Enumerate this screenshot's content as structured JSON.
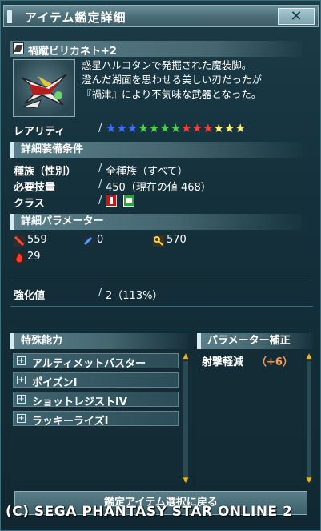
{
  "window": {
    "title": "アイテム鑑定詳細",
    "close_label": "✕"
  },
  "item": {
    "name": "禍蹴ビリカネト+2",
    "type_icon": "weapon-type-icon",
    "description": [
      "惑星ハルコタンで発掘された魔装脚。",
      "澄んだ湖面を思わせる美しい刃だったが",
      "『禍津』により不気味な武器となった。"
    ],
    "rarity_label": "レアリティ",
    "rarity_stars": 13,
    "star_colors": [
      "#3d6dff",
      "#3d6dff",
      "#3d6dff",
      "#4fd14f",
      "#4fd14f",
      "#4fd14f",
      "#4fd14f",
      "#ff3b3b",
      "#ff3b3b",
      "#ff3b3b",
      "#ffef7a",
      "#ffef7a",
      "#ffef7a"
    ]
  },
  "requirements": {
    "section_title": "詳細装備条件",
    "rows": [
      {
        "label": "種族（性別）",
        "value": "全種族（すべて）"
      },
      {
        "label": "必要技量",
        "value": "450（現在の値 468）"
      },
      {
        "label": "クラス",
        "value": ""
      }
    ],
    "class_icons": [
      "hunter-class-icon",
      "ranger-class-icon"
    ]
  },
  "parameters": {
    "section_title": "詳細パラメーター",
    "melee_attack": "559",
    "ranged_attack": "0",
    "dexterity": "570",
    "element": "29"
  },
  "grind": {
    "label": "強化値",
    "value": "2（113%）"
  },
  "abilities": {
    "section_title": "特殊能力",
    "items": [
      "アルティメットバスター",
      "ポイズンI",
      "ショットレジストIV",
      "ラッキーライズI"
    ]
  },
  "param_bonus": {
    "section_title": "パラメーター補正",
    "label": "射撃軽減",
    "value": "（+6）"
  },
  "footer": {
    "return_button": "鑑定アイテム選択に戻る",
    "copyright": "(C) SEGA   PHANTASY STAR ONLINE 2"
  },
  "colors": {
    "accent_orange": "#ff9a4a",
    "scroll_arrow": "#f2b600"
  }
}
